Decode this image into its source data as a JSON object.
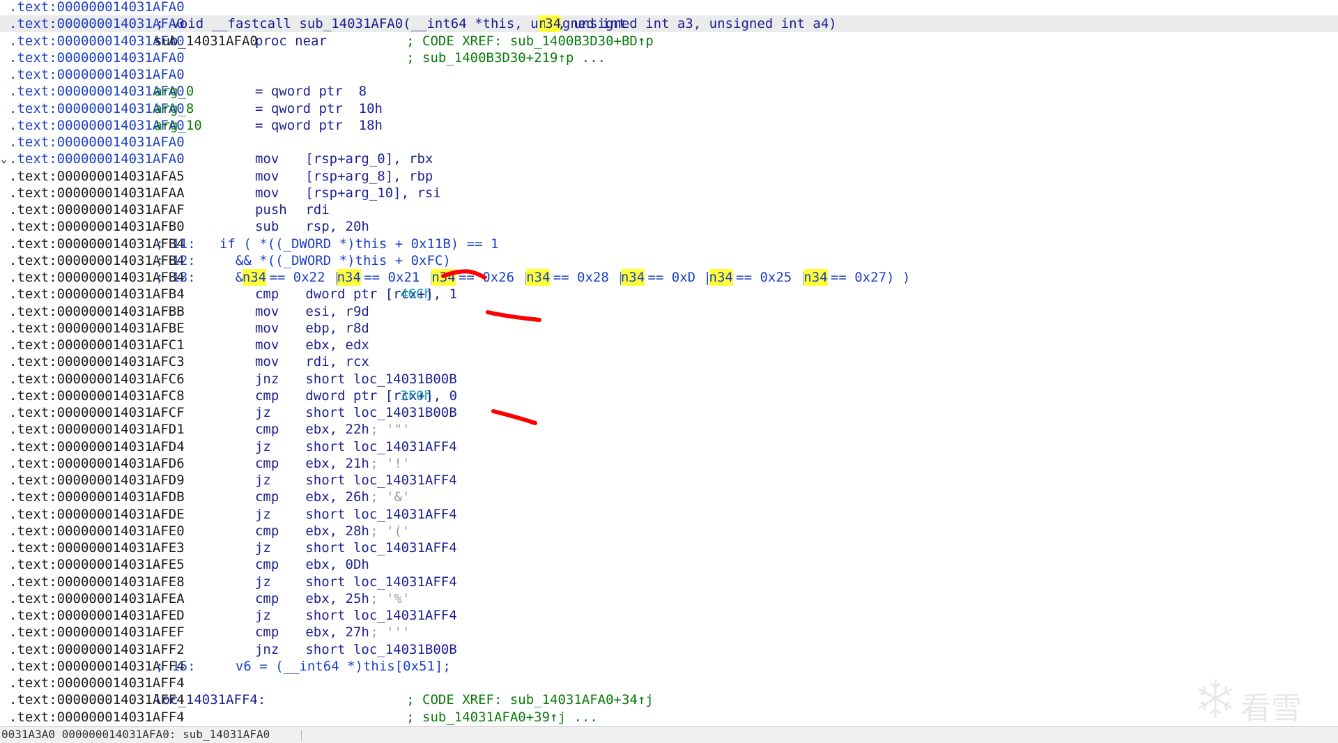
{
  "colors": {
    "address_highlight": "#1b3fc4",
    "current_line": "#ebebeb",
    "search_highlight": "#ffff38",
    "annotation_stroke": "#ff0000"
  },
  "listing": {
    "current_line_index": 1,
    "lines": [
      {
        "addr": ".text:000000014031AFA0",
        "addr_color": "blue",
        "segs": [],
        "arrow": ""
      },
      {
        "addr": ".text:000000014031AFA0",
        "addr_color": "blue",
        "arrow": "",
        "segs": [
          {
            "col": 22,
            "text": " ; void __fastcall sub_14031AFA0(__int64 *this, unsigned int ",
            "color": "code"
          },
          {
            "col": 84,
            "text": "n",
            "color": "code",
            "hl": true
          },
          {
            "col": 85,
            "text": "34",
            "color": "code",
            "hl": true
          },
          {
            "col": 87,
            "text": ", unsigned int a3, unsigned int a4)",
            "color": "code"
          }
        ]
      },
      {
        "addr": ".text:000000014031AFA0",
        "addr_color": "blue",
        "arrow": "",
        "segs": [
          {
            "col": 23,
            "text": "sub_14031AFA0",
            "color": "name"
          },
          {
            "col": 39,
            "text": "proc near",
            "color": "code"
          },
          {
            "col": 63,
            "text": "; CODE XREF: sub_1400B3D30+BD↑p",
            "color": "green"
          }
        ]
      },
      {
        "addr": ".text:000000014031AFA0",
        "addr_color": "blue",
        "arrow": "",
        "segs": [
          {
            "col": 63,
            "text": "; sub_1400B3D30+219↑p ...",
            "color": "green"
          }
        ]
      },
      {
        "addr": ".text:000000014031AFA0",
        "addr_color": "blue",
        "arrow": "",
        "segs": []
      },
      {
        "addr": ".text:000000014031AFA0",
        "addr_color": "blue",
        "arrow": "",
        "segs": [
          {
            "col": 23,
            "text": "arg_0",
            "color": "green"
          },
          {
            "col": 39,
            "text": "= qword ptr  8",
            "color": "code"
          }
        ]
      },
      {
        "addr": ".text:000000014031AFA0",
        "addr_color": "blue",
        "arrow": "",
        "segs": [
          {
            "col": 23,
            "text": "arg_8",
            "color": "green"
          },
          {
            "col": 39,
            "text": "= qword ptr  10h",
            "color": "code"
          }
        ]
      },
      {
        "addr": ".text:000000014031AFA0",
        "addr_color": "blue",
        "arrow": "",
        "segs": [
          {
            "col": 23,
            "text": "arg_10",
            "color": "green"
          },
          {
            "col": 39,
            "text": "= qword ptr  18h",
            "color": "code"
          }
        ]
      },
      {
        "addr": ".text:000000014031AFA0",
        "addr_color": "blue",
        "arrow": "",
        "segs": []
      },
      {
        "addr": ".text:000000014031AFA0",
        "addr_color": "blue",
        "arrow": "⌄",
        "segs": [
          {
            "col": 39,
            "text": "mov",
            "color": "code"
          },
          {
            "col": 47,
            "text": "[rsp+arg_0], rbx",
            "color": "code"
          }
        ]
      },
      {
        "addr": ".text:000000014031AFA5",
        "addr_color": "black",
        "arrow": "",
        "segs": [
          {
            "col": 39,
            "text": "mov",
            "color": "code"
          },
          {
            "col": 47,
            "text": "[rsp+arg_8], rbp",
            "color": "code"
          }
        ]
      },
      {
        "addr": ".text:000000014031AFAA",
        "addr_color": "black",
        "arrow": "",
        "segs": [
          {
            "col": 39,
            "text": "mov",
            "color": "code"
          },
          {
            "col": 47,
            "text": "[rsp+arg_10], rsi",
            "color": "code"
          }
        ]
      },
      {
        "addr": ".text:000000014031AFAF",
        "addr_color": "black",
        "arrow": "",
        "segs": [
          {
            "col": 39,
            "text": "push",
            "color": "code"
          },
          {
            "col": 47,
            "text": "rdi",
            "color": "code"
          }
        ]
      },
      {
        "addr": ".text:000000014031AFB0",
        "addr_color": "black",
        "arrow": "",
        "segs": [
          {
            "col": 39,
            "text": "sub",
            "color": "code"
          },
          {
            "col": 47,
            "text": "rsp, 20h",
            "color": "code"
          }
        ]
      },
      {
        "addr": ".text:000000014031AFB4",
        "addr_color": "black",
        "arrow": "",
        "segs": [
          {
            "col": 22,
            "text": " ; 11:   if ( *((_DWORD *)this + 0x11B) == 1",
            "color": "cmt"
          }
        ]
      },
      {
        "addr": ".text:000000014031AFB4",
        "addr_color": "black",
        "arrow": "",
        "segs": [
          {
            "col": 22,
            "text": " ; 12:     && *((_DWORD *)this + 0xFC)",
            "color": "cmt"
          }
        ]
      },
      {
        "addr": ".text:000000014031AFB4",
        "addr_color": "black",
        "arrow": "",
        "segs": [
          {
            "col": 22,
            "text": " ; 13:     && (",
            "color": "cmt"
          },
          {
            "col": 37,
            "text": "n34",
            "color": "cmt",
            "hl": true
          },
          {
            "col": 40,
            "text": " == 0x22 || ",
            "color": "cmt"
          },
          {
            "col": 52,
            "text": "n34",
            "color": "cmt",
            "hl": true
          },
          {
            "col": 55,
            "text": " == 0x21 || ",
            "color": "cmt"
          },
          {
            "col": 67,
            "text": "n34",
            "color": "cmt",
            "hl": true
          },
          {
            "col": 70,
            "text": " == 0x26 || ",
            "color": "cmt"
          },
          {
            "col": 82,
            "text": "n34",
            "color": "cmt",
            "hl": true
          },
          {
            "col": 85,
            "text": " == 0x28 || ",
            "color": "cmt"
          },
          {
            "col": 97,
            "text": "n34",
            "color": "cmt",
            "hl": true
          },
          {
            "col": 100,
            "text": " == 0xD || ",
            "color": "cmt"
          },
          {
            "col": 111,
            "text": "n34",
            "color": "cmt",
            "hl": true
          },
          {
            "col": 114,
            "text": " == 0x25 || ",
            "color": "cmt"
          },
          {
            "col": 126,
            "text": "n34",
            "color": "cmt",
            "hl": true
          },
          {
            "col": 129,
            "text": " == 0x27) )",
            "color": "cmt"
          }
        ]
      },
      {
        "addr": ".text:000000014031AFB4",
        "addr_color": "black",
        "arrow": "",
        "segs": [
          {
            "col": 39,
            "text": "cmp",
            "color": "code"
          },
          {
            "col": 47,
            "text": "dword ptr [rcx+",
            "color": "code"
          },
          {
            "col": 62,
            "text": "46Ch",
            "color": "cyan"
          },
          {
            "col": 66,
            "text": "], 1",
            "color": "code"
          }
        ]
      },
      {
        "addr": ".text:000000014031AFBB",
        "addr_color": "black",
        "arrow": "",
        "segs": [
          {
            "col": 39,
            "text": "mov",
            "color": "code"
          },
          {
            "col": 47,
            "text": "esi, r9d",
            "color": "code"
          }
        ]
      },
      {
        "addr": ".text:000000014031AFBE",
        "addr_color": "black",
        "arrow": "",
        "segs": [
          {
            "col": 39,
            "text": "mov",
            "color": "code"
          },
          {
            "col": 47,
            "text": "ebp, r8d",
            "color": "code"
          }
        ]
      },
      {
        "addr": ".text:000000014031AFC1",
        "addr_color": "black",
        "arrow": "",
        "segs": [
          {
            "col": 39,
            "text": "mov",
            "color": "code"
          },
          {
            "col": 47,
            "text": "ebx, edx",
            "color": "code"
          }
        ]
      },
      {
        "addr": ".text:000000014031AFC3",
        "addr_color": "black",
        "arrow": "",
        "segs": [
          {
            "col": 39,
            "text": "mov",
            "color": "code"
          },
          {
            "col": 47,
            "text": "rdi, rcx",
            "color": "code"
          }
        ]
      },
      {
        "addr": ".text:000000014031AFC6",
        "addr_color": "black",
        "arrow": "",
        "segs": [
          {
            "col": 39,
            "text": "jnz",
            "color": "code"
          },
          {
            "col": 47,
            "text": "short loc_14031B00B",
            "color": "code"
          }
        ]
      },
      {
        "addr": ".text:000000014031AFC8",
        "addr_color": "black",
        "arrow": "",
        "segs": [
          {
            "col": 39,
            "text": "cmp",
            "color": "code"
          },
          {
            "col": 47,
            "text": "dword ptr [rcx+",
            "color": "code"
          },
          {
            "col": 62,
            "text": "3F0h",
            "color": "cyan"
          },
          {
            "col": 66,
            "text": "], 0",
            "color": "code"
          }
        ]
      },
      {
        "addr": ".text:000000014031AFCF",
        "addr_color": "black",
        "arrow": "",
        "segs": [
          {
            "col": 39,
            "text": "jz",
            "color": "code"
          },
          {
            "col": 47,
            "text": "short loc_14031B00B",
            "color": "code"
          }
        ]
      },
      {
        "addr": ".text:000000014031AFD1",
        "addr_color": "black",
        "arrow": "",
        "segs": [
          {
            "col": 39,
            "text": "cmp",
            "color": "code"
          },
          {
            "col": 47,
            "text": "ebx, 22h",
            "color": "code"
          },
          {
            "col": 56,
            "text": " ; '\"'",
            "color": "muted"
          }
        ]
      },
      {
        "addr": ".text:000000014031AFD4",
        "addr_color": "black",
        "arrow": "",
        "segs": [
          {
            "col": 39,
            "text": "jz",
            "color": "code"
          },
          {
            "col": 47,
            "text": "short loc_14031AFF4",
            "color": "code"
          }
        ]
      },
      {
        "addr": ".text:000000014031AFD6",
        "addr_color": "black",
        "arrow": "",
        "segs": [
          {
            "col": 39,
            "text": "cmp",
            "color": "code"
          },
          {
            "col": 47,
            "text": "ebx, 21h",
            "color": "code"
          },
          {
            "col": 56,
            "text": " ; '!'",
            "color": "muted"
          }
        ]
      },
      {
        "addr": ".text:000000014031AFD9",
        "addr_color": "black",
        "arrow": "",
        "segs": [
          {
            "col": 39,
            "text": "jz",
            "color": "code"
          },
          {
            "col": 47,
            "text": "short loc_14031AFF4",
            "color": "code"
          }
        ]
      },
      {
        "addr": ".text:000000014031AFDB",
        "addr_color": "black",
        "arrow": "",
        "segs": [
          {
            "col": 39,
            "text": "cmp",
            "color": "code"
          },
          {
            "col": 47,
            "text": "ebx, 26h",
            "color": "code"
          },
          {
            "col": 56,
            "text": " ; '&'",
            "color": "muted"
          }
        ]
      },
      {
        "addr": ".text:000000014031AFDE",
        "addr_color": "black",
        "arrow": "",
        "segs": [
          {
            "col": 39,
            "text": "jz",
            "color": "code"
          },
          {
            "col": 47,
            "text": "short loc_14031AFF4",
            "color": "code"
          }
        ]
      },
      {
        "addr": ".text:000000014031AFE0",
        "addr_color": "black",
        "arrow": "",
        "segs": [
          {
            "col": 39,
            "text": "cmp",
            "color": "code"
          },
          {
            "col": 47,
            "text": "ebx, 28h",
            "color": "code"
          },
          {
            "col": 56,
            "text": " ; '('",
            "color": "muted"
          }
        ]
      },
      {
        "addr": ".text:000000014031AFE3",
        "addr_color": "black",
        "arrow": "",
        "segs": [
          {
            "col": 39,
            "text": "jz",
            "color": "code"
          },
          {
            "col": 47,
            "text": "short loc_14031AFF4",
            "color": "code"
          }
        ]
      },
      {
        "addr": ".text:000000014031AFE5",
        "addr_color": "black",
        "arrow": "",
        "segs": [
          {
            "col": 39,
            "text": "cmp",
            "color": "code"
          },
          {
            "col": 47,
            "text": "ebx, 0Dh",
            "color": "code"
          }
        ]
      },
      {
        "addr": ".text:000000014031AFE8",
        "addr_color": "black",
        "arrow": "",
        "segs": [
          {
            "col": 39,
            "text": "jz",
            "color": "code"
          },
          {
            "col": 47,
            "text": "short loc_14031AFF4",
            "color": "code"
          }
        ]
      },
      {
        "addr": ".text:000000014031AFEA",
        "addr_color": "black",
        "arrow": "",
        "segs": [
          {
            "col": 39,
            "text": "cmp",
            "color": "code"
          },
          {
            "col": 47,
            "text": "ebx, 25h",
            "color": "code"
          },
          {
            "col": 56,
            "text": " ; '%'",
            "color": "muted"
          }
        ]
      },
      {
        "addr": ".text:000000014031AFED",
        "addr_color": "black",
        "arrow": "",
        "segs": [
          {
            "col": 39,
            "text": "jz",
            "color": "code"
          },
          {
            "col": 47,
            "text": "short loc_14031AFF4",
            "color": "code"
          }
        ]
      },
      {
        "addr": ".text:000000014031AFEF",
        "addr_color": "black",
        "arrow": "",
        "segs": [
          {
            "col": 39,
            "text": "cmp",
            "color": "code"
          },
          {
            "col": 47,
            "text": "ebx, 27h",
            "color": "code"
          },
          {
            "col": 56,
            "text": " ; '''",
            "color": "muted"
          }
        ]
      },
      {
        "addr": ".text:000000014031AFF2",
        "addr_color": "black",
        "arrow": "",
        "segs": [
          {
            "col": 39,
            "text": "jnz",
            "color": "code"
          },
          {
            "col": 47,
            "text": "short loc_14031B00B",
            "color": "code"
          }
        ]
      },
      {
        "addr": ".text:000000014031AFF4",
        "addr_color": "black",
        "arrow": "",
        "segs": [
          {
            "col": 22,
            "text": " ; 15:     v6 = (__int64 *)this[0x51];",
            "color": "cmt"
          }
        ]
      },
      {
        "addr": ".text:000000014031AFF4",
        "addr_color": "black",
        "arrow": "",
        "segs": []
      },
      {
        "addr": ".text:000000014031AFF4",
        "addr_color": "black",
        "arrow": "",
        "segs": [
          {
            "col": 23,
            "text": "loc_14031AFF4:",
            "color": "code"
          },
          {
            "col": 63,
            "text": "; CODE XREF: sub_14031AFA0+34↑j",
            "color": "green"
          }
        ]
      },
      {
        "addr": ".text:000000014031AFF4",
        "addr_color": "black",
        "arrow": "",
        "segs": [
          {
            "col": 63,
            "text": "; sub_14031AFA0+39↑j ...",
            "color": "green"
          }
        ]
      }
    ]
  },
  "status_bar": {
    "text": "0031A3A0 000000014031AFA0: sub_14031AFA0"
  },
  "watermark": {
    "logo": "snowflake-icon",
    "text": "看雪"
  }
}
